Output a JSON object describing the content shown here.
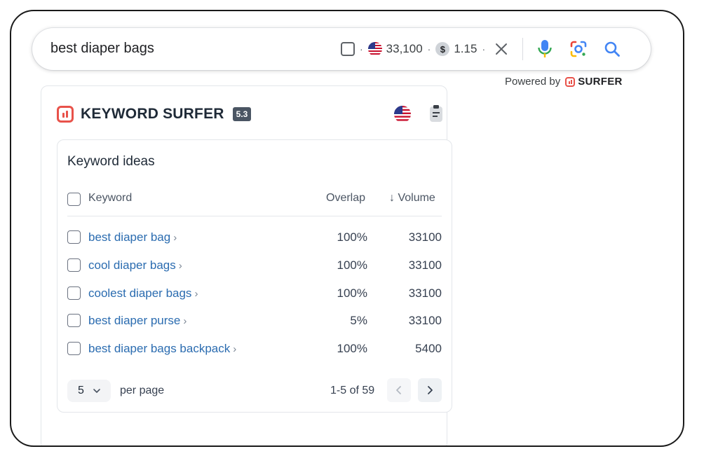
{
  "search": {
    "query": "best diaper bags",
    "volume": "33,100",
    "cpc": "1.15",
    "dot": "·",
    "dollar": "$"
  },
  "powered": {
    "prefix": "Powered by",
    "brand": "SURFER"
  },
  "panel": {
    "title": "KEYWORD SURFER",
    "version": "5.3",
    "card_title": "Keyword ideas",
    "columns": {
      "keyword": "Keyword",
      "overlap": "Overlap",
      "volume": "↓ Volume"
    },
    "rows": [
      {
        "keyword": "best diaper bag",
        "overlap": "100%",
        "volume": "33100"
      },
      {
        "keyword": "cool diaper bags",
        "overlap": "100%",
        "volume": "33100"
      },
      {
        "keyword": "coolest diaper bags",
        "overlap": "100%",
        "volume": "33100"
      },
      {
        "keyword": "best diaper purse",
        "overlap": "5%",
        "volume": "33100"
      },
      {
        "keyword": "best diaper bags backpack",
        "overlap": "100%",
        "volume": "5400"
      }
    ],
    "chevron": "›",
    "pagination": {
      "per_page_value": "5",
      "per_page_label": "per page",
      "range": "1-5 of 59"
    }
  },
  "icons": {
    "flag": "us-flag-icon",
    "coin": "dollar-coin-icon",
    "close": "close-icon",
    "mic": "microphone-icon",
    "lens": "google-lens-icon",
    "search": "search-icon",
    "clipboard": "clipboard-icon"
  },
  "colors": {
    "link": "#2b6cb0",
    "surfer_red": "#e8524a",
    "google_blue": "#4285f4"
  }
}
